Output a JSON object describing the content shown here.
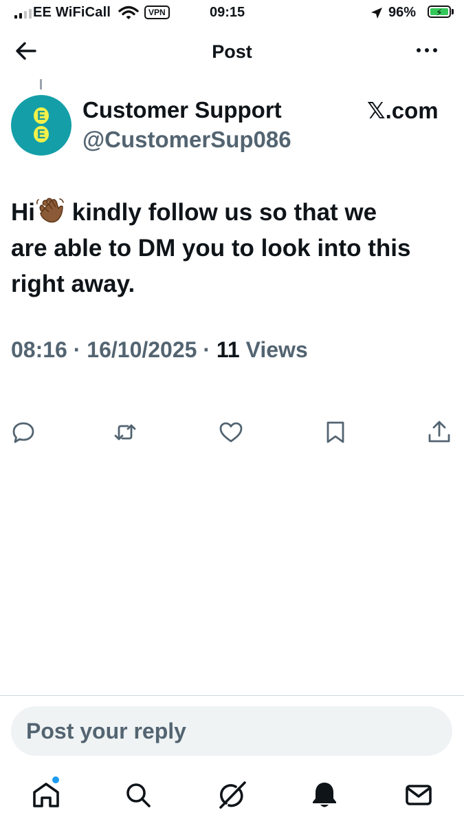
{
  "status_bar": {
    "carrier": "EE WiFiCall",
    "vpn": "VPN",
    "time": "09:15",
    "battery": "96%"
  },
  "header": {
    "title": "Post"
  },
  "post": {
    "author": {
      "display_name": "Customer Support",
      "handle": "@CustomerSup086",
      "avatar_letters": [
        "E",
        "E"
      ]
    },
    "source": "𝕏.com",
    "text_line_1_start": "Hi",
    "text_line_1_end": " kindly follow us so that we",
    "text_line_2": "are able to DM you to look into this",
    "text_line_3": "right away.",
    "time": "08:16",
    "date": "16/10/2025",
    "views_count": "11",
    "views_label": "Views"
  },
  "actions": [
    "reply-icon",
    "repost-icon",
    "like-icon",
    "bookmark-icon",
    "share-icon"
  ],
  "reply": {
    "placeholder": "Post your reply"
  },
  "nav": [
    "home-icon",
    "search-icon",
    "grok-icon",
    "notifications-icon",
    "messages-icon"
  ],
  "colors": {
    "text": "#0f1419",
    "secondary": "#536471",
    "avatar_bg": "#149fa8",
    "avatar_letter_bg": "#f1f14a",
    "accent": "#1d9bf0",
    "battery": "#34c759"
  }
}
